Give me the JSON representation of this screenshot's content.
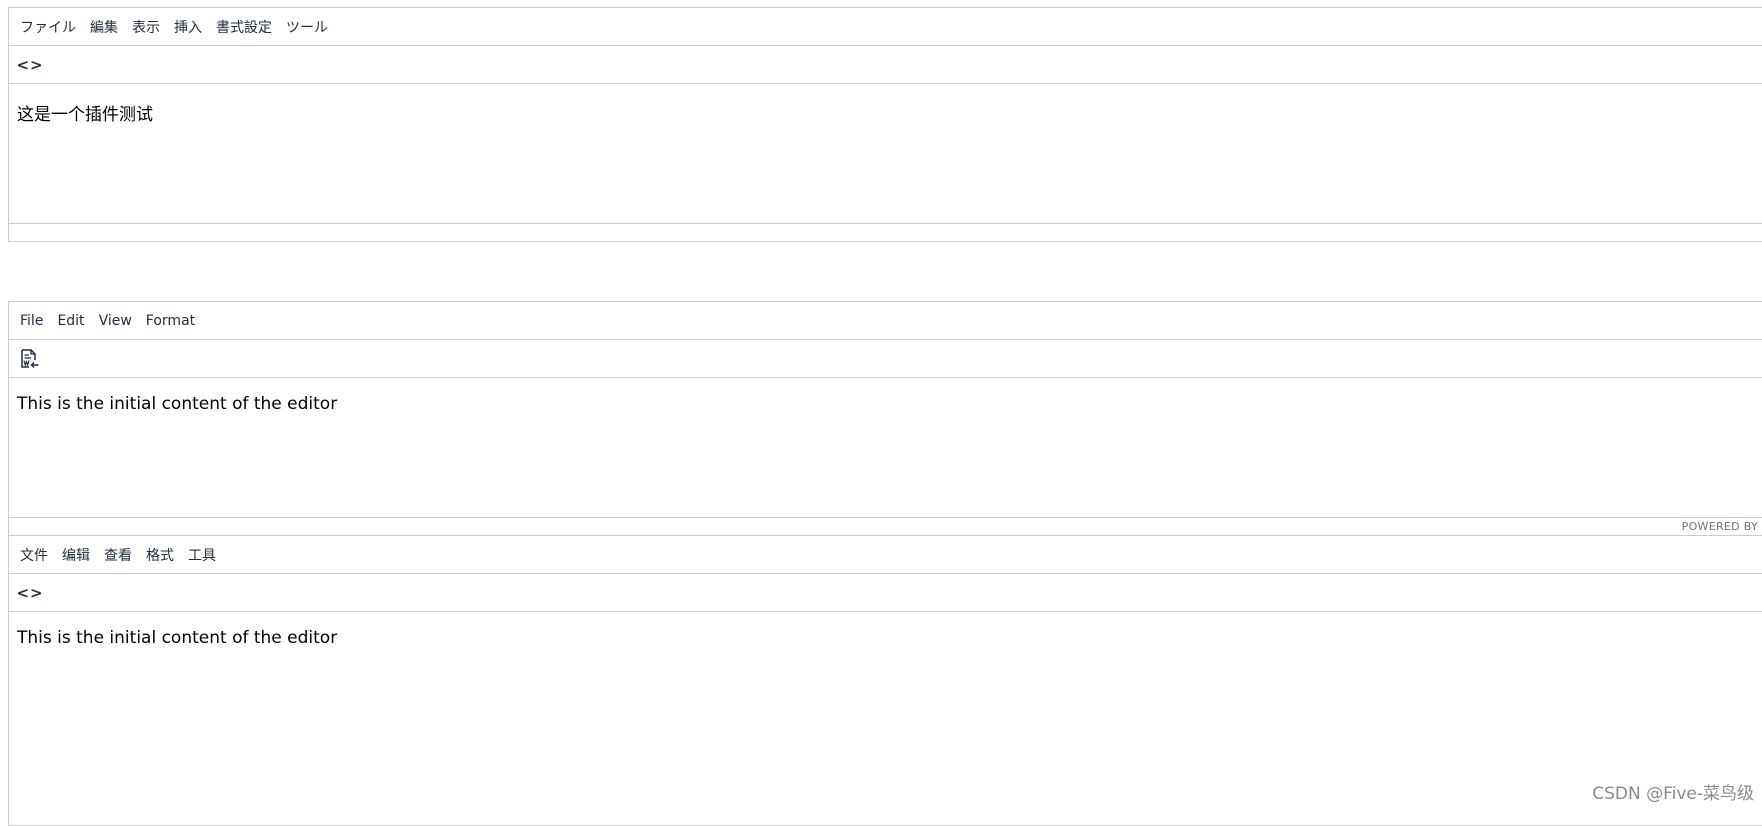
{
  "editors": [
    {
      "menu": [
        "ファイル",
        "編集",
        "表示",
        "挿入",
        "書式設定",
        "ツール"
      ],
      "toolbar_icon": "code-icon",
      "toolbar_glyph": "<>",
      "content": "这是一个插件测试"
    },
    {
      "menu": [
        "File",
        "Edit",
        "View",
        "Format"
      ],
      "toolbar_icon": "export-word-icon",
      "content": "This is the initial content of the editor",
      "status": "POWERED BY"
    },
    {
      "menu": [
        "文件",
        "编辑",
        "查看",
        "格式",
        "工具"
      ],
      "toolbar_icon": "code-icon",
      "toolbar_glyph": "<>",
      "content": "This is the initial content of the editor"
    }
  ],
  "watermark": "CSDN @Five-菜鸟级"
}
